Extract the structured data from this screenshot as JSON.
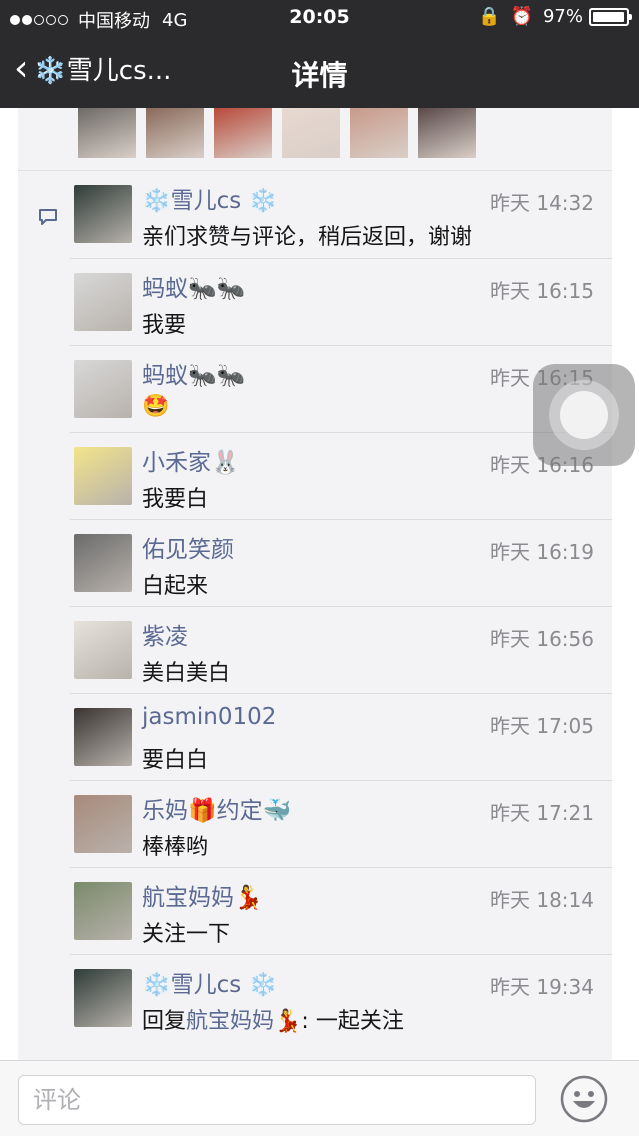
{
  "status_bar": {
    "carrier": "中国移动",
    "network": "4G",
    "time": "20:05",
    "battery": "97%",
    "battery_level": 0.97
  },
  "nav": {
    "back_label": "❄️雪儿cs...",
    "title": "详情"
  },
  "comments": [
    {
      "name": "❄️雪儿cs ❄️",
      "time": "昨天 14:32",
      "text": "亲们求赞与评论，稍后返回，谢谢",
      "avatar_color": "#2f3c38"
    },
    {
      "name": "蚂蚁🐜🐜",
      "time": "昨天 16:15",
      "text": "我要",
      "avatar_color": "#d8d8d8"
    },
    {
      "name": "蚂蚁🐜🐜",
      "time": "昨天 16:15",
      "text": "🤩",
      "avatar_color": "#d8d8d8"
    },
    {
      "name": "小禾家🐰",
      "time": "昨天 16:16",
      "text": "我要白",
      "avatar_color": "#f3e48a"
    },
    {
      "name": "佑见笑颜",
      "time": "昨天 16:19",
      "text": "白起来",
      "avatar_color": "#6b6b6b"
    },
    {
      "name": "紫凌",
      "time": "昨天 16:56",
      "text": "美白美白",
      "avatar_color": "#e8e2dc"
    },
    {
      "name": "jasmin0102",
      "time": "昨天 17:05",
      "text": "要白白",
      "avatar_color": "#3a3432"
    },
    {
      "name": "乐妈🎁约定🐳",
      "time": "昨天 17:21",
      "text": "棒棒哟",
      "avatar_color": "#a88a7a"
    },
    {
      "name": "航宝妈妈💃",
      "time": "昨天 18:14",
      "text": "关注一下",
      "avatar_color": "#7a8a6a"
    },
    {
      "name": "❄️雪儿cs ❄️",
      "time": "昨天 19:34",
      "reply_prefix": "回复",
      "reply_to": "航宝妈妈💃",
      "reply_text": ": 一起关注",
      "avatar_color": "#2f3c38"
    }
  ],
  "likes_avatars": [
    "#6e6a66",
    "#8a6a5a",
    "#b84a3a",
    "#e8d8d0",
    "#c89a8a",
    "#5a4a4a"
  ],
  "input": {
    "placeholder": "评论"
  },
  "colors": {
    "name_color": "#5b6a92",
    "top_bar": "#2b2b2d",
    "panel_bg": "#f3f3f5"
  }
}
